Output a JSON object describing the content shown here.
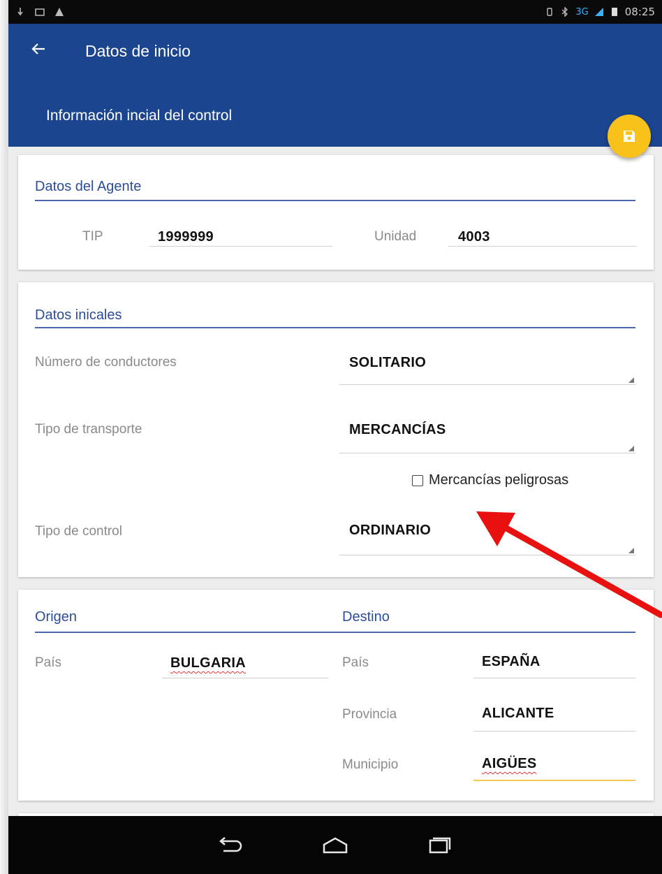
{
  "statusbar": {
    "time": "08:25",
    "network": "3G"
  },
  "appbar": {
    "title": "Datos de inicio",
    "subtitle": "Información incial del control"
  },
  "agente": {
    "title": "Datos del Agente",
    "tip_label": "TIP",
    "tip_value": "1999999",
    "unidad_label": "Unidad",
    "unidad_value": "4003"
  },
  "iniciales": {
    "title": "Datos inicales",
    "conductores_label": "Número de conductores",
    "conductores_value": "SOLITARIO",
    "transporte_label": "Tipo de transporte",
    "transporte_value": "MERCANCÍAS",
    "peligrosas_label": "Mercancías peligrosas",
    "control_label": "Tipo de control",
    "control_value": "ORDINARIO"
  },
  "origen": {
    "title": "Origen",
    "pais_label": "País",
    "pais_value": "BULGARIA"
  },
  "destino": {
    "title": "Destino",
    "pais_label": "País",
    "pais_value": "ESPAÑA",
    "provincia_label": "Provincia",
    "provincia_value": "ALICANTE",
    "municipio_label": "Municipio",
    "municipio_value": "AIGÜES"
  },
  "colors": {
    "primary": "#1c4590",
    "accent": "#f8c21b",
    "annotation_arrow": "#e8110f"
  }
}
